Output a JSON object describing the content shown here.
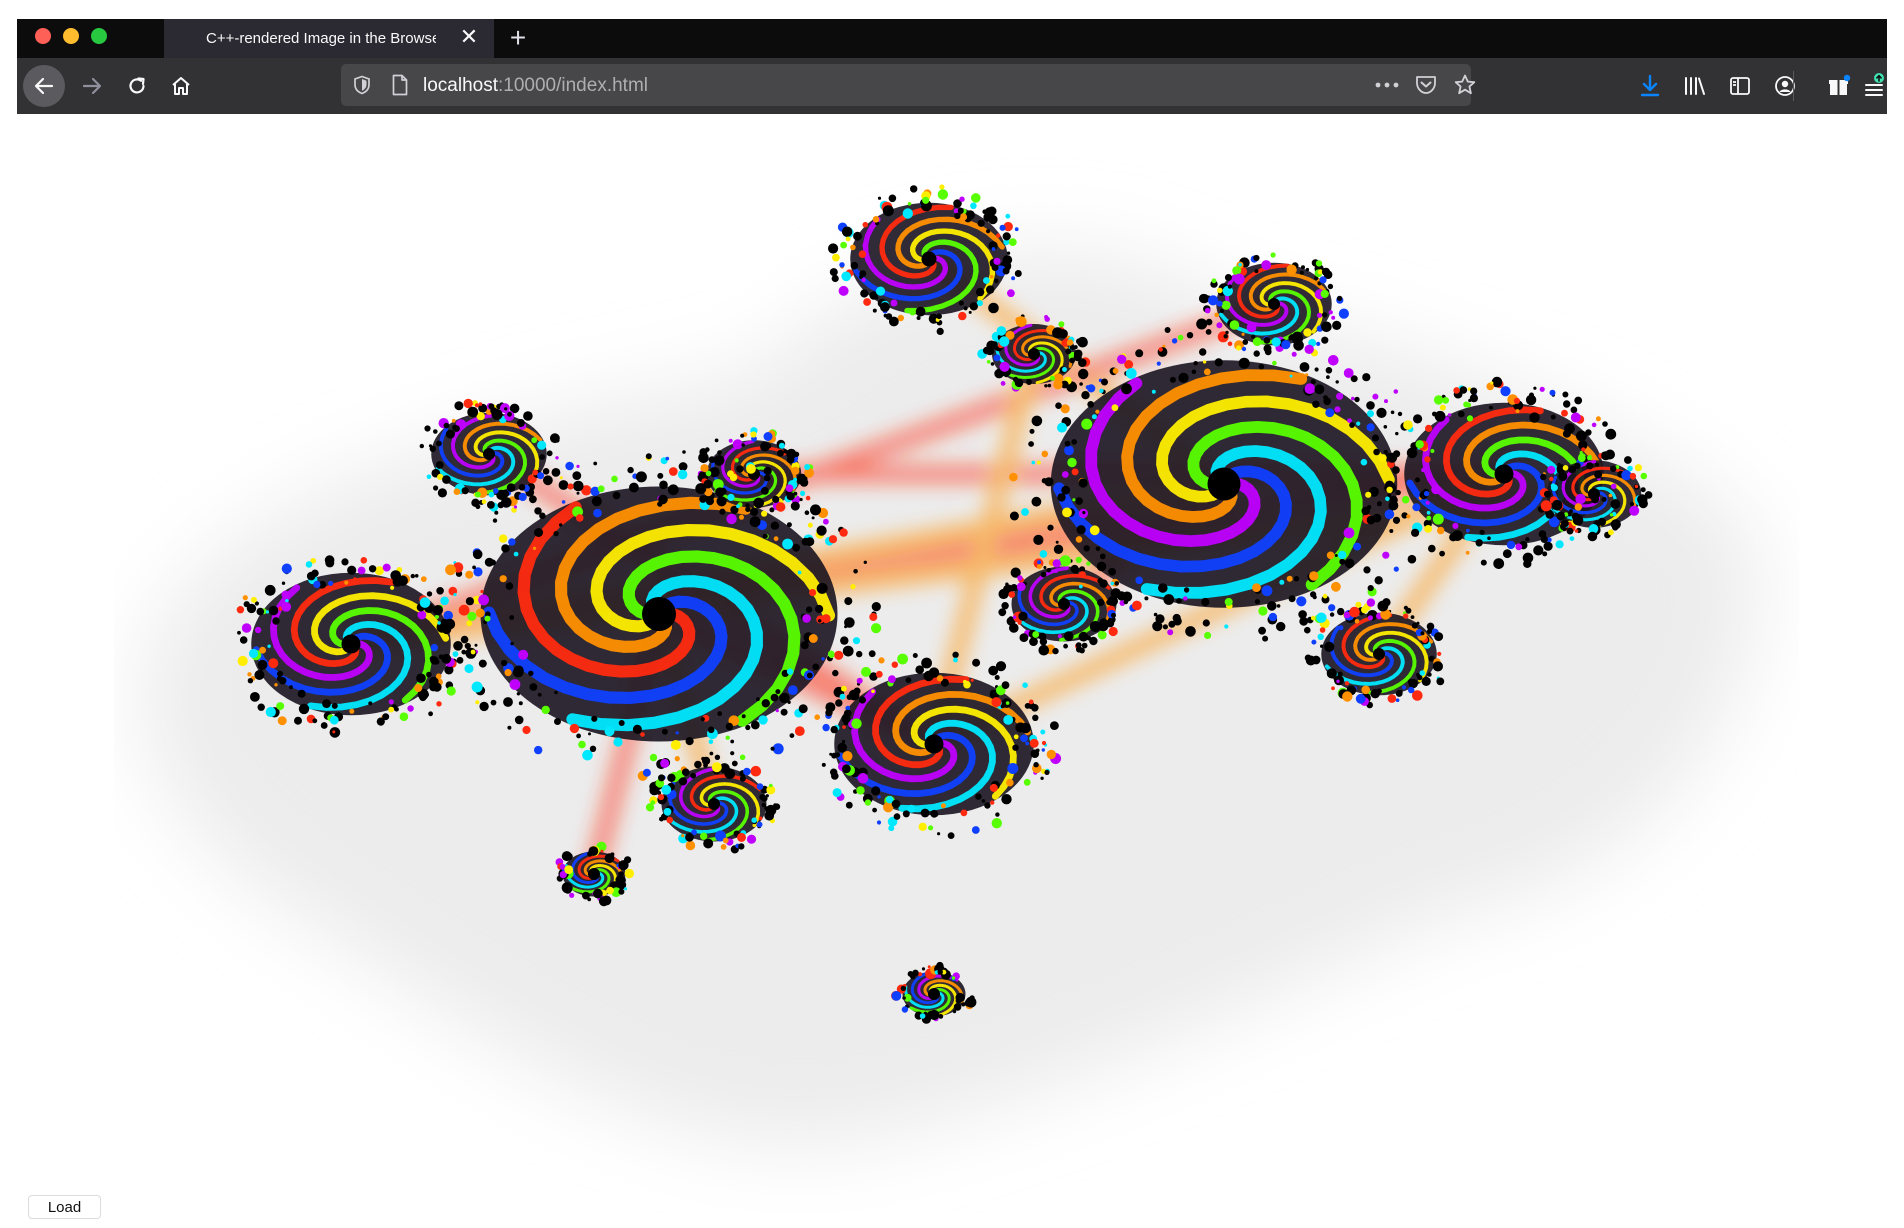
{
  "browser": {
    "tab": {
      "title": "C++-rendered Image in the Browser"
    },
    "url": {
      "host": "localhost",
      "rest": ":10000/index.html"
    },
    "accent_color": "#0a84ff",
    "icons": [
      "back-arrow-icon",
      "forward-arrow-icon",
      "reload-icon",
      "home-icon",
      "shield-icon",
      "page-icon",
      "more-dots-icon",
      "pocket-icon",
      "bookmark-star-icon",
      "download-arrow-icon",
      "library-icon",
      "sidebar-icon",
      "account-icon",
      "gift-icon",
      "menu-icon"
    ]
  },
  "page": {
    "image": {
      "subject": "Julia set fractal, rainbow-coloured spirals on white background",
      "palette": [
        "#ff2a10",
        "#ff9000",
        "#ffee00",
        "#58ff00",
        "#00e8ff",
        "#1040ff",
        "#c000ff",
        "#000000"
      ]
    },
    "load_button": {
      "label": "Load"
    }
  }
}
